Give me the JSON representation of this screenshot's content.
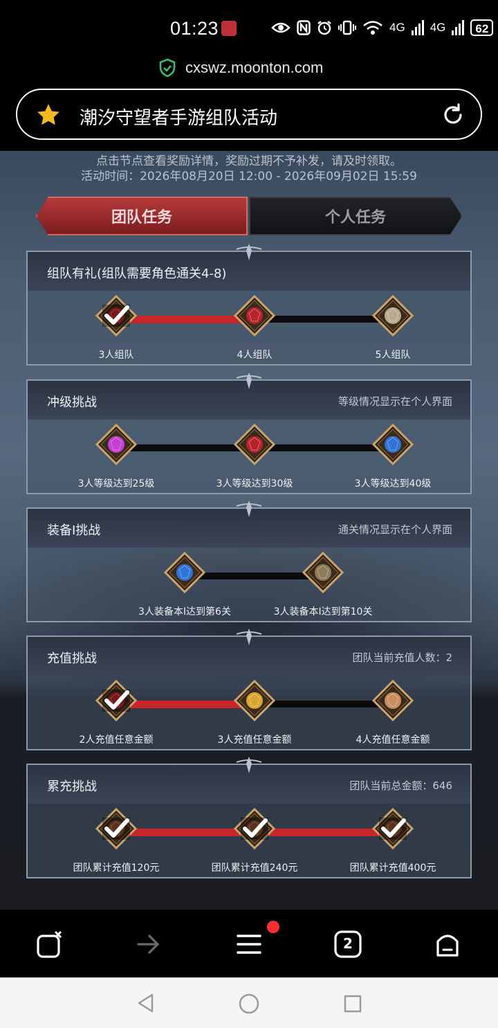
{
  "status": {
    "time": "01:23",
    "battery": "62",
    "signal_1": "4G",
    "signal_2": "4G"
  },
  "browser": {
    "url": "cxswz.moonton.com",
    "page_title": "潮汐守望者手游组队活动",
    "open_tabs": "2"
  },
  "notice": {
    "line1": "点击节点查看奖励详情，奖励过期不予补发，请及时领取。",
    "line2": "活动时间：2026年08月20日 12:00 - 2026年09月02日 15:59"
  },
  "tabs": {
    "team": "团队任务",
    "personal": "个人任务"
  },
  "cards": [
    {
      "name": "组队有礼(组队需要角色通关4-8)",
      "note": "",
      "nodes": [
        {
          "label": "3人组队",
          "claimed": true,
          "icon": "red-gem-icon"
        },
        {
          "label": "4人组队",
          "claimed": false,
          "icon": "red-gem-icon"
        },
        {
          "label": "5人组队",
          "claimed": false,
          "icon": "armor-icon"
        }
      ],
      "progress_segments": 1
    },
    {
      "name": "冲级挑战",
      "note": "等级情况显示在个人界面",
      "nodes": [
        {
          "label": "3人等级达到25级",
          "claimed": false,
          "icon": "purple-crystal-icon"
        },
        {
          "label": "3人等级达到30级",
          "claimed": false,
          "icon": "red-gem-icon"
        },
        {
          "label": "3人等级达到40级",
          "claimed": false,
          "icon": "blue-amulet-icon"
        }
      ],
      "progress_segments": 0
    },
    {
      "name": "装备I挑战",
      "note": "通关情况显示在个人界面",
      "nodes": [
        {
          "label": "3人装备本I达到第6关",
          "claimed": false,
          "icon": "blue-amulet-icon"
        },
        {
          "label": "3人装备本I达到第10关",
          "claimed": false,
          "icon": "gear-bag-icon"
        }
      ],
      "progress_segments": 0
    },
    {
      "name": "充值挑战",
      "note": "团队当前充值人数：2",
      "nodes": [
        {
          "label": "2人充值任意金额",
          "claimed": true,
          "icon": "red-gem-icon"
        },
        {
          "label": "3人充值任意金额",
          "claimed": false,
          "icon": "gold-orb-icon"
        },
        {
          "label": "4人充值任意金额",
          "claimed": false,
          "icon": "food-bowl-icon"
        }
      ],
      "progress_segments": 1
    },
    {
      "name": "累充挑战",
      "note": "团队当前总金额：646",
      "nodes": [
        {
          "label": "团队累计充值120元",
          "claimed": true,
          "icon": "weapon-icon"
        },
        {
          "label": "团队累计充值240元",
          "claimed": true,
          "icon": "weapon-icon"
        },
        {
          "label": "团队累计充值400元",
          "claimed": true,
          "icon": "weapon-icon"
        }
      ],
      "progress_segments": 2
    }
  ],
  "colors": {
    "progress_active": "#c8262b",
    "progress_inactive": "#0b0b0d",
    "tab_active": "#a52f31",
    "star": "#f7b81c",
    "shield": "#2fbf71",
    "notification": "#ff2d2d"
  }
}
